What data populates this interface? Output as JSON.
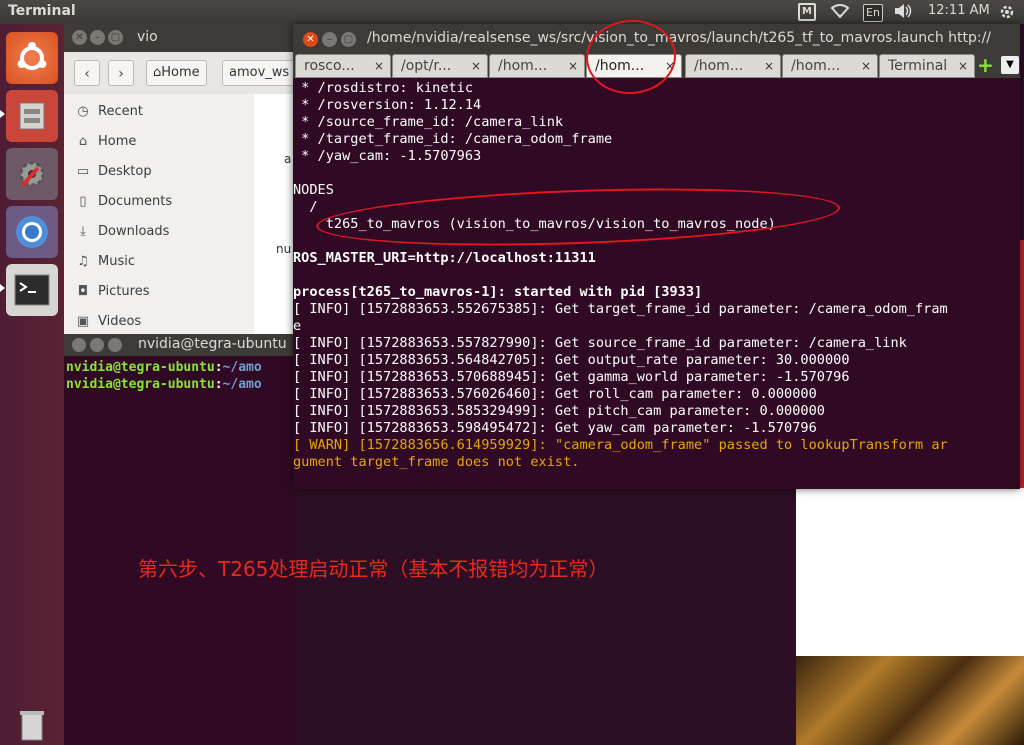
{
  "topbar": {
    "app_title": "Terminal",
    "keyboard": "En",
    "clock": "12:11 AM",
    "box_label": "M"
  },
  "file_manager": {
    "title": "vio",
    "crumbs": [
      "Home",
      "amov_ws"
    ],
    "sidebar": [
      "Recent",
      "Home",
      "Desktop",
      "Documents",
      "Downloads",
      "Music",
      "Pictures",
      "Videos"
    ],
    "content_fragments": [
      "a",
      "nu"
    ]
  },
  "small_terminal": {
    "title": "nvidia@tegra-ubuntu",
    "prompts": [
      {
        "user": "nvidia@tegra-ubuntu",
        "path": "~/amo"
      },
      {
        "user": "nvidia@tegra-ubuntu",
        "path": "~/amo"
      }
    ]
  },
  "main_terminal": {
    "title": "/home/nvidia/realsense_ws/src/vision_to_mavros/launch/t265_tf_to_mavros.launch http://",
    "tabs": [
      "rosco...",
      "/opt/r...",
      "/hom...",
      "/hom...",
      "/hom...",
      "/hom...",
      "Terminal"
    ],
    "lines": [
      " * /rosdistro: kinetic",
      " * /rosversion: 1.12.14",
      " * /source_frame_id: /camera_link",
      " * /target_frame_id: /camera_odom_frame",
      " * /yaw_cam: -1.5707963",
      "",
      "NODES",
      "  /",
      "    t265_to_mavros (vision_to_mavros/vision_to_mavros_node)",
      "",
      "ROS_MASTER_URI=http://localhost:11311",
      "",
      "process[t265_to_mavros-1]: started with pid [3933]",
      "[ INFO] [1572883653.552675385]: Get target_frame_id parameter: /camera_odom_fram",
      "e",
      "[ INFO] [1572883653.557827990]: Get source_frame_id parameter: /camera_link",
      "[ INFO] [1572883653.564842705]: Get output_rate parameter: 30.000000",
      "[ INFO] [1572883653.570688945]: Get gamma_world parameter: -1.570796",
      "[ INFO] [1572883653.576026460]: Get roll_cam parameter: 0.000000",
      "[ INFO] [1572883653.585329499]: Get pitch_cam parameter: 0.000000",
      "[ INFO] [1572883653.598495472]: Get yaw_cam parameter: -1.570796",
      "[ WARN] [1572883656.614959929]: \"camera_odom_frame\" passed to lookupTransform ar",
      "gument target_frame does not exist."
    ]
  },
  "caption": "第六步、T265处理启动正常（基本不报错均为正常）",
  "colors": {
    "terminal_bg": "#300a24",
    "warn": "#e5a50a",
    "annotation": "#e3151f",
    "caption": "#e8291c"
  }
}
